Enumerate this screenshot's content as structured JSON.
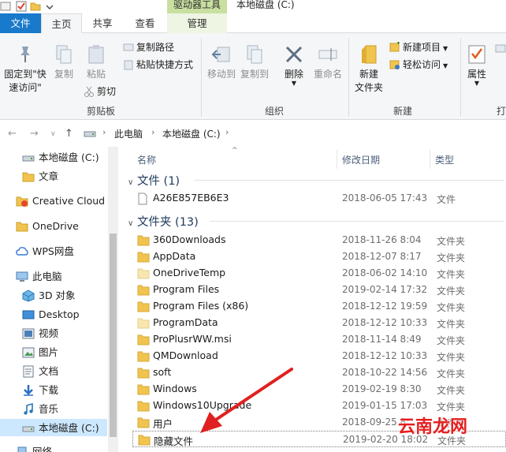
{
  "window": {
    "context_group": "驱动器工具",
    "title": "本地磁盘 (C:)"
  },
  "tabs": [
    {
      "label": "文件"
    },
    {
      "label": "主页"
    },
    {
      "label": "共享"
    },
    {
      "label": "查看"
    },
    {
      "label": "管理"
    }
  ],
  "ribbon": {
    "pin": {
      "label1": "固定到\"快",
      "label2": "速访问\""
    },
    "copy": "复制",
    "paste": "粘贴",
    "copy_path": "复制路径",
    "paste_shortcut": "粘贴快捷方式",
    "cut": "剪切",
    "clipboard_group": "剪贴板",
    "move_to": "移动到",
    "copy_to": "复制到",
    "delete": "删除",
    "rename": "重命名",
    "organize_group": "组织",
    "new_folder": {
      "label1": "新建",
      "label2": "文件夹"
    },
    "new_item": "新建项目",
    "easy_access": "轻松访问",
    "new_group": "新建",
    "properties": "属性",
    "open_group_partial": "打"
  },
  "address": {
    "crumbs": [
      "此电脑",
      "本地磁盘 (C:)"
    ]
  },
  "nav": {
    "items": [
      {
        "label": "本地磁盘 (C:)",
        "icon": "drive-icon"
      },
      {
        "label": "文章",
        "icon": "folder-icon"
      },
      {
        "label": "Creative Cloud F",
        "icon": "creative-cloud-icon"
      },
      {
        "label": "OneDrive",
        "icon": "folder-icon"
      },
      {
        "label": "WPS网盘",
        "icon": "wps-cloud-icon"
      },
      {
        "label": "此电脑",
        "icon": "computer-icon"
      },
      {
        "label": "3D 对象",
        "icon": "3d-objects-icon"
      },
      {
        "label": "Desktop",
        "icon": "desktop-icon"
      },
      {
        "label": "视频",
        "icon": "video-icon"
      },
      {
        "label": "图片",
        "icon": "pictures-icon"
      },
      {
        "label": "文档",
        "icon": "documents-icon"
      },
      {
        "label": "下载",
        "icon": "download-icon"
      },
      {
        "label": "音乐",
        "icon": "music-icon"
      },
      {
        "label": "本地磁盘 (C:)",
        "icon": "drive-icon"
      },
      {
        "label": "网络",
        "icon": "network-icon"
      }
    ]
  },
  "list": {
    "columns": {
      "name": "名称",
      "modified": "修改日期",
      "type": "类型"
    },
    "files_group": "文件 (1)",
    "folders_group": "文件夹 (13)",
    "files": [
      {
        "name": "A26E857EB6E3",
        "date": "2018-06-05 17:43",
        "type": "文件"
      }
    ],
    "folders": [
      {
        "name": "360Downloads",
        "date": "2018-11-26 8:04",
        "type": "文件夹"
      },
      {
        "name": "AppData",
        "date": "2018-12-07 8:17",
        "type": "文件夹"
      },
      {
        "name": "OneDriveTemp",
        "date": "2018-06-02 14:10",
        "type": "文件夹"
      },
      {
        "name": "Program Files",
        "date": "2019-02-14 17:32",
        "type": "文件夹"
      },
      {
        "name": "Program Files (x86)",
        "date": "2018-12-12 19:59",
        "type": "文件夹"
      },
      {
        "name": "ProgramData",
        "date": "2018-12-12 10:33",
        "type": "文件夹"
      },
      {
        "name": "ProPlusrWW.msi",
        "date": "2018-11-14 8:49",
        "type": "文件夹"
      },
      {
        "name": "QMDownload",
        "date": "2018-12-12 10:33",
        "type": "文件夹"
      },
      {
        "name": "soft",
        "date": "2018-10-22 14:56",
        "type": "文件夹"
      },
      {
        "name": "Windows",
        "date": "2019-02-19 8:30",
        "type": "文件夹"
      },
      {
        "name": "Windows10Upgrade",
        "date": "2019-01-15 17:03",
        "type": "文件夹"
      },
      {
        "name": "用户",
        "date": "2018-09-25 8:",
        "type": "文件夹"
      },
      {
        "name": "隐藏文件",
        "date": "2019-02-20 18:02",
        "type": "文件夹"
      }
    ]
  },
  "watermark": "云南龙网",
  "colors": {
    "file_tab": "#1979ca",
    "context_group": "#c9dfa0",
    "nav_selected": "#cce8ff",
    "folder": "#f1c44f",
    "annotation_arrow": "#e02020",
    "watermark": "#e51e1e"
  }
}
